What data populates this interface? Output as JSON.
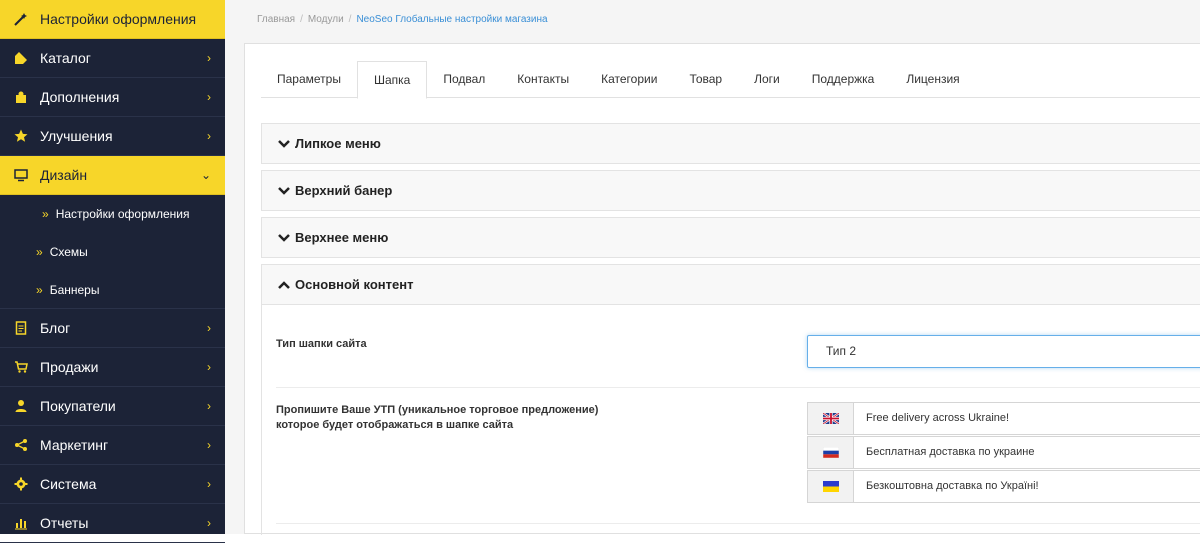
{
  "sidebar": {
    "top_item": {
      "label": "Настройки оформления",
      "icon": "magic-wand-icon"
    },
    "items": [
      {
        "label": "Каталог",
        "icon": "tag-icon"
      },
      {
        "label": "Дополнения",
        "icon": "puzzle-icon"
      },
      {
        "label": "Улучшения",
        "icon": "star-icon"
      },
      {
        "label": "Дизайн",
        "icon": "monitor-icon"
      }
    ],
    "design_sub": [
      {
        "label": "Настройки оформления"
      },
      {
        "label": "Схемы"
      },
      {
        "label": "Баннеры"
      }
    ],
    "items_after": [
      {
        "label": "Блог",
        "icon": "document-icon"
      },
      {
        "label": "Продажи",
        "icon": "cart-icon"
      },
      {
        "label": "Покупатели",
        "icon": "user-icon"
      },
      {
        "label": "Маркетинг",
        "icon": "share-icon"
      },
      {
        "label": "Система",
        "icon": "gear-icon"
      },
      {
        "label": "Отчеты",
        "icon": "bar-chart-icon"
      }
    ],
    "colors": {
      "background": "#1c2337",
      "accent": "#f7d629"
    }
  },
  "breadcrumb": {
    "items": [
      "Главная",
      "Модули",
      "NeoSeo Глобальные настройки магазина"
    ]
  },
  "tabs": [
    {
      "label": "Параметры"
    },
    {
      "label": "Шапка"
    },
    {
      "label": "Подвал"
    },
    {
      "label": "Контакты"
    },
    {
      "label": "Категории"
    },
    {
      "label": "Товар"
    },
    {
      "label": "Логи"
    },
    {
      "label": "Поддержка"
    },
    {
      "label": "Лицензия"
    }
  ],
  "active_tab": "Шапка",
  "sections": [
    {
      "title": "Липкое меню",
      "expanded": false
    },
    {
      "title": "Верхний банер",
      "expanded": false
    },
    {
      "title": "Верхнее меню",
      "expanded": false
    },
    {
      "title": "Основной контент",
      "expanded": true
    }
  ],
  "content": {
    "header_type": {
      "label": "Тип шапки сайта",
      "value": "Тип 2"
    },
    "usp": {
      "label_line1": "Пропишите Ваше УТП (уникальное торговое предложение)",
      "label_line2": "которое будет отображаться в шапке сайта",
      "entries": [
        {
          "flag": "uk-flag-icon",
          "value": "Free delivery across Ukraine!"
        },
        {
          "flag": "ru-flag-icon",
          "value": "Бесплатная доставка по украине"
        },
        {
          "flag": "ua-flag-icon",
          "value": "Безкоштовна доставка по Україні!"
        }
      ]
    }
  }
}
